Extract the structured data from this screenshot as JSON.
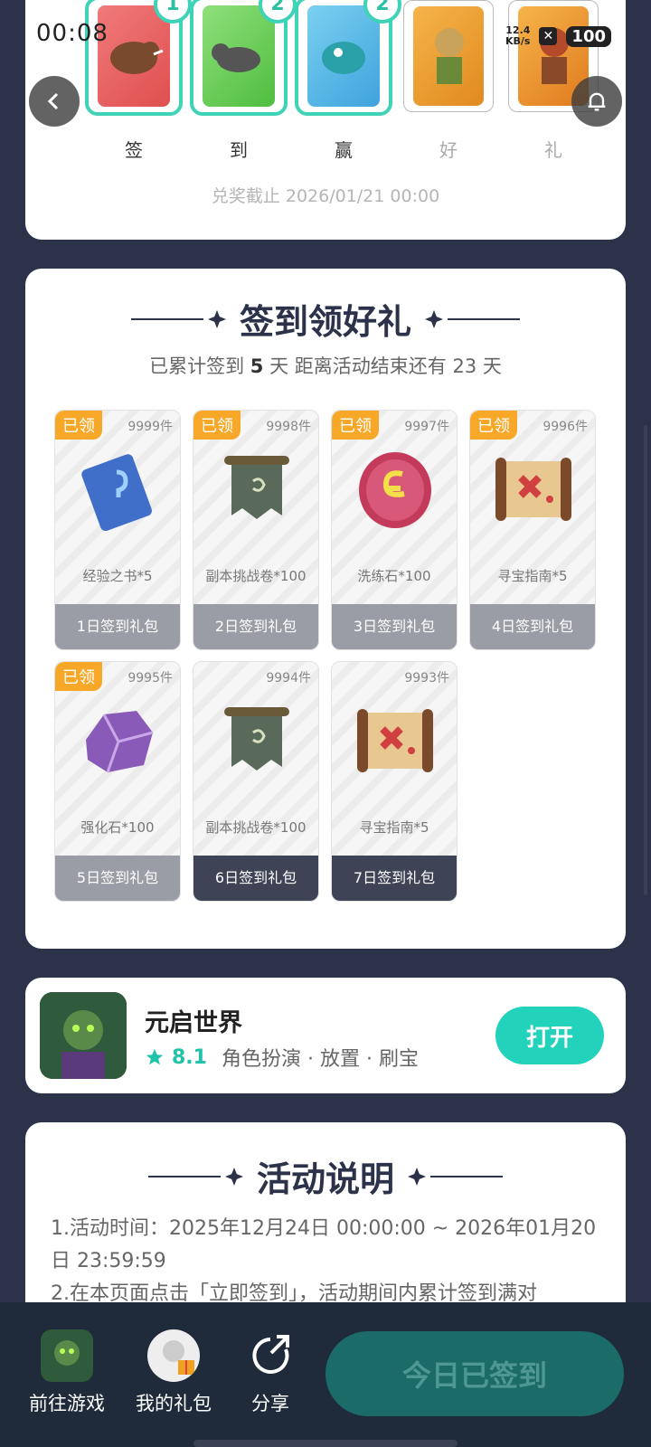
{
  "status_bar": {
    "time": "00:08",
    "net_speed_value": "12.4",
    "net_speed_unit": "KB/s",
    "battery": "100"
  },
  "top": {
    "prizes": [
      {
        "name": "wild-boar-card",
        "count": "1",
        "owned": true,
        "char": "签"
      },
      {
        "name": "wolf-card",
        "count": "2",
        "owned": true,
        "char": "到"
      },
      {
        "name": "fish-card",
        "count": "2",
        "owned": true,
        "char": "赢"
      },
      {
        "name": "viking-card",
        "count": "",
        "owned": false,
        "char": "好"
      },
      {
        "name": "warrior-card",
        "count": "",
        "owned": false,
        "char": "礼"
      }
    ],
    "deadline": "兑奖截止 2026/01/21 00:00"
  },
  "signin": {
    "title": "签到领好礼",
    "subtitle_prefix": "已累计签到",
    "days_signed": "5",
    "subtitle_mid": "天  距离活动结束还有",
    "days_left": "23",
    "subtitle_suffix": "天",
    "gifts": [
      {
        "claimed": "已领",
        "stock": "9999件",
        "name": "经验之书*5",
        "day": "1日签到礼包",
        "icon": "experience-book-icon"
      },
      {
        "claimed": "已领",
        "stock": "9998件",
        "name": "副本挑战卷*100",
        "day": "2日签到礼包",
        "icon": "dungeon-scroll-icon"
      },
      {
        "claimed": "已领",
        "stock": "9997件",
        "name": "洗练石*100",
        "day": "3日签到礼包",
        "icon": "refine-stone-icon"
      },
      {
        "claimed": "已领",
        "stock": "9996件",
        "name": "寻宝指南*5",
        "day": "4日签到礼包",
        "icon": "treasure-map-icon"
      },
      {
        "claimed": "已领",
        "stock": "9995件",
        "name": "强化石*100",
        "day": "5日签到礼包",
        "icon": "enhance-stone-icon"
      },
      {
        "claimed": "",
        "stock": "9994件",
        "name": "副本挑战卷*100",
        "day": "6日签到礼包",
        "icon": "dungeon-scroll-icon"
      },
      {
        "claimed": "",
        "stock": "9993件",
        "name": "寻宝指南*5",
        "day": "7日签到礼包",
        "icon": "treasure-map-icon"
      }
    ]
  },
  "game": {
    "name": "元启世界",
    "rating": "8.1",
    "tags": "角色扮演 · 放置 · 刷宝",
    "open_label": "打开"
  },
  "rules": {
    "title": "活动说明",
    "line1": "1.活动时间：2025年12月24日 00:00:00 ~ 2026年01月20日 23:59:59",
    "line2": "2.在本页面点击「立即签到」，活动期间内累计签到满对"
  },
  "bottom": {
    "goto_game": "前往游戏",
    "my_gifts": "我的礼包",
    "share": "分享",
    "signed_label": "今日已签到"
  },
  "colors": {
    "accent": "#22d2bb",
    "claimed": "#f8a829",
    "background": "#2b3249"
  }
}
